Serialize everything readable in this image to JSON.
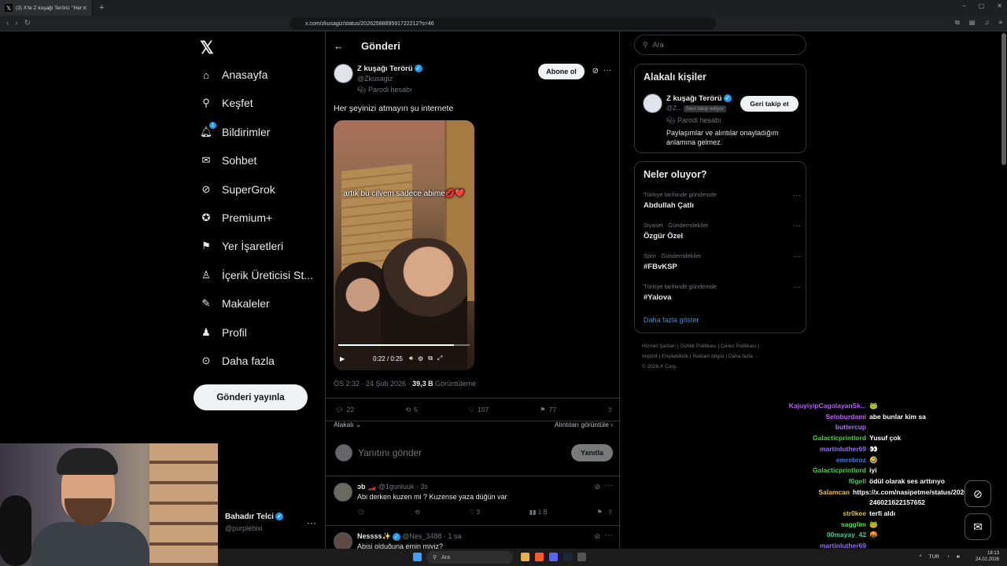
{
  "browser": {
    "tab_title": "(3) X'te Z kuşağı Terörü: \"Her şeyi",
    "url": "x.com/zkusagiz/status/2026258889591722212?s=46"
  },
  "nav": {
    "items": [
      {
        "label": "Anasayfa",
        "icon": "home-icon"
      },
      {
        "label": "Keşfet",
        "icon": "search-icon"
      },
      {
        "label": "Bildirimler",
        "icon": "bell-icon",
        "badge": "1"
      },
      {
        "label": "Sohbet",
        "icon": "mail-icon"
      },
      {
        "label": "SuperGrok",
        "icon": "grok-icon"
      },
      {
        "label": "Premium+",
        "icon": "verified-icon"
      },
      {
        "label": "Yer İşaretleri",
        "icon": "bookmark-icon"
      },
      {
        "label": "İçerik Üreticisi St...",
        "icon": "creator-icon"
      },
      {
        "label": "Makaleler",
        "icon": "article-icon"
      },
      {
        "label": "Profil",
        "icon": "person-icon"
      },
      {
        "label": "Daha fazla",
        "icon": "more-icon"
      }
    ],
    "post_button": "Gönderi yayınla",
    "account_name": "Bahadır Telci",
    "account_handle": "@purplebixi"
  },
  "main": {
    "header": "Gönderi",
    "author_name": "Z kuşağı Terörü",
    "author_handle": "@Zkusagiz",
    "parody_label": "Parodi hesabı",
    "follow_button": "Abone ol",
    "text": "Her şeyinizi atmayın şu internete",
    "video_caption": "artık bu cilvem sadece abime💋❤️",
    "video_time": "0:22 / 0:25",
    "video_progress": 0.88,
    "time": "ÖS 2:32 · 24 Şub 2026 · ",
    "views": "39,3 B",
    "views_label": " Görüntüleme",
    "stats": {
      "replies": "22",
      "reposts": "5",
      "likes": "107",
      "bookmarks": "77"
    },
    "sort_label": "Alakalı",
    "quotes_label": "Alıntıları görüntüle",
    "reply_placeholder": "Yanıtını gönder",
    "reply_button": "Yanıtla",
    "replies": [
      {
        "name": "ɔb 🏎️",
        "handle": "@1gunluuk · 3s",
        "text": "Abi derken kuzen mi ? Kuzense yaza düğün var",
        "likes": "3",
        "views": "1 B"
      },
      {
        "name": "Nessss✨",
        "handle": "@Nes_3488 · 1 sa",
        "text": "Abisi olduğuna emin miyiz?"
      }
    ]
  },
  "right": {
    "search_placeholder": "Ara",
    "related_title": "Alakalı kişiler",
    "related_name": "Z kuşağı Terörü",
    "related_handle": "@Z...",
    "follows_you": "Seni takip ediyor",
    "related_parody": "Parodi hesabı",
    "related_bio": "Paylaşımlar ve alıntılar onayladığım anlamına gelmez.",
    "followback_button": "Geri takip et",
    "trends_title": "Neler oluyor?",
    "trends": [
      {
        "context": "Türkiye tarihinde gündemde",
        "topic": "Abdullah Çatlı"
      },
      {
        "context": "Siyaset · Gündemdekiler",
        "topic": "Özgür Özel"
      },
      {
        "context": "Spor · Gündemdekiler",
        "topic": "#FBvKSP"
      },
      {
        "context": "Türkiye tarihinde gündemde",
        "topic": "#Yalova"
      }
    ],
    "show_more": "Daha fazla göster",
    "footer_line1": "Hizmet Şartları  |  Gizlilik Politikası  |  Çerez Politikası  |",
    "footer_line2": "Imprint  |  Erişilebilirlik  |  Reklam bilgisi  |  Daha fazla ···",
    "footer_line3": "© 2026 X Corp."
  },
  "chat": [
    {
      "user": "KajuyiyipCagolayanSk...",
      "color": "#b65cff",
      "msg": "🐸"
    },
    {
      "user": "Seloburdami",
      "color": "#c85bff",
      "msg": "abe bunlar kim sa"
    },
    {
      "user": "buttercup",
      "color": "#a970ff",
      "msg": ""
    },
    {
      "user": "Galacticprintlord",
      "color": "#49d341",
      "msg": "Yusuf çok"
    },
    {
      "user": "martinluther69",
      "color": "#9b6bff",
      "msg": "👀"
    },
    {
      "user": "emrebroz",
      "color": "#3a7bff",
      "msg": "🤣"
    },
    {
      "user": "Galacticprintlord",
      "color": "#49d341",
      "msg": "iyi"
    },
    {
      "user": "f0gell",
      "color": "#33cc66",
      "msg": "ödül olarak ses arttırıyo"
    },
    {
      "user": "Salamcan",
      "color": "#f0c040",
      "msg": "https://x.com/nasipetme/status/2026"
    },
    {
      "user": "",
      "color": "#ffffff",
      "msg": "246021622157652"
    },
    {
      "user": "str0kee",
      "color": "#e0c030",
      "msg": "terfi aldı"
    },
    {
      "user": "sagglim",
      "color": "#50e050",
      "msg": "🐸"
    },
    {
      "user": "00mayay_42",
      "color": "#3ad0a0",
      "msg": "🤬"
    },
    {
      "user": "martinluther69",
      "color": "#9b6bff",
      "msg": ""
    }
  ],
  "taskbar": {
    "search": "Ara",
    "lang": "TUR",
    "time": "18:13",
    "date": "24.02.2026"
  }
}
